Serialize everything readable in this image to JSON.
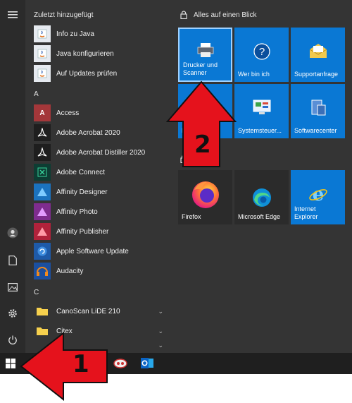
{
  "recently_added": {
    "title": "Zuletzt hinzugefügt",
    "items": [
      {
        "label": "Info zu Java",
        "icon": "java-icon"
      },
      {
        "label": "Java konfigurieren",
        "icon": "java-icon"
      },
      {
        "label": "Auf Updates prüfen",
        "icon": "java-icon"
      }
    ]
  },
  "section_a": {
    "letter": "A",
    "items": [
      {
        "label": "Access",
        "icon": "access-icon"
      },
      {
        "label": "Adobe Acrobat 2020",
        "icon": "acrobat-icon"
      },
      {
        "label": "Adobe Acrobat Distiller 2020",
        "icon": "acrobat-distiller-icon"
      },
      {
        "label": "Adobe Connect",
        "icon": "adobe-connect-icon"
      },
      {
        "label": "Affinity Designer",
        "icon": "affinity-designer-icon"
      },
      {
        "label": "Affinity Photo",
        "icon": "affinity-photo-icon"
      },
      {
        "label": "Affinity Publisher",
        "icon": "affinity-publisher-icon"
      },
      {
        "label": "Apple Software Update",
        "icon": "apple-update-icon"
      },
      {
        "label": "Audacity",
        "icon": "audacity-icon"
      }
    ]
  },
  "section_c": {
    "letter": "C",
    "items": [
      {
        "label": "CanoScan LiDE 210",
        "icon": "folder-icon"
      },
      {
        "label": "Citex",
        "icon": "folder-icon"
      }
    ]
  },
  "groups": [
    {
      "title": "Alles auf einen Blick"
    }
  ],
  "tiles": [
    {
      "label": "Drucker und\nScanner",
      "icon": "printer-icon"
    },
    {
      "label": "Wer bin ich",
      "icon": "question-icon"
    },
    {
      "label": "Supportanfrage",
      "icon": "mail-icon"
    },
    {
      "label": "Ex",
      "icon": "explorer-icon"
    },
    {
      "label": "Systemsteuer...",
      "icon": "control-panel-icon"
    },
    {
      "label": "Softwarecenter",
      "icon": "software-center-icon"
    },
    {
      "label": "Firefox",
      "icon": "firefox-icon"
    },
    {
      "label": "Microsoft Edge",
      "icon": "edge-icon"
    },
    {
      "label": "Internet\nExplorer",
      "icon": "internet-explorer-icon"
    }
  ],
  "callouts": {
    "one": "1",
    "two": "2"
  },
  "colors": {
    "start_bg": "#343434",
    "tile_blue": "#0a78d4",
    "tile_dark": "#2b2b2b",
    "arrow_red": "#e5121c",
    "taskbar": "#1f1f1f"
  }
}
